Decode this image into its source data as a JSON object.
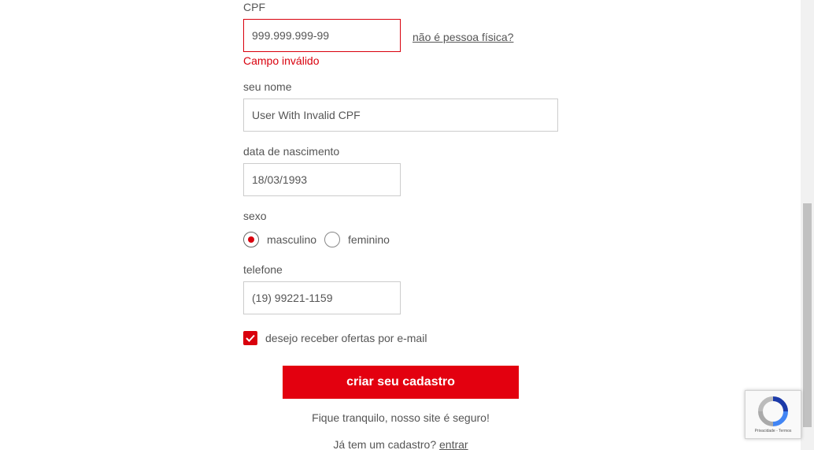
{
  "form": {
    "cpf": {
      "label": "CPF",
      "value": "999.999.999-99",
      "alt_link": "não é pessoa física?",
      "error": "Campo inválido"
    },
    "name": {
      "label": "seu nome",
      "value": "User With Invalid CPF"
    },
    "birthdate": {
      "label": "data de nascimento",
      "value": "18/03/1993"
    },
    "sex": {
      "label": "sexo",
      "options": [
        "masculino",
        "feminino"
      ],
      "selected": "masculino"
    },
    "phone": {
      "label": "telefone",
      "value": "(19) 99221-1159"
    },
    "newsletter": {
      "label": "desejo receber ofertas por e-mail",
      "checked": true
    },
    "submit_label": "criar seu cadastro",
    "secure_note": "Fique tranquilo, nosso site é seguro!",
    "login_prompt": "Já tem um cadastro?",
    "login_link": "entrar"
  },
  "recaptcha": {
    "footer": "Privacidade - Termos"
  },
  "colors": {
    "accent": "#e3000f",
    "error": "#d9000d",
    "text": "#555555"
  }
}
